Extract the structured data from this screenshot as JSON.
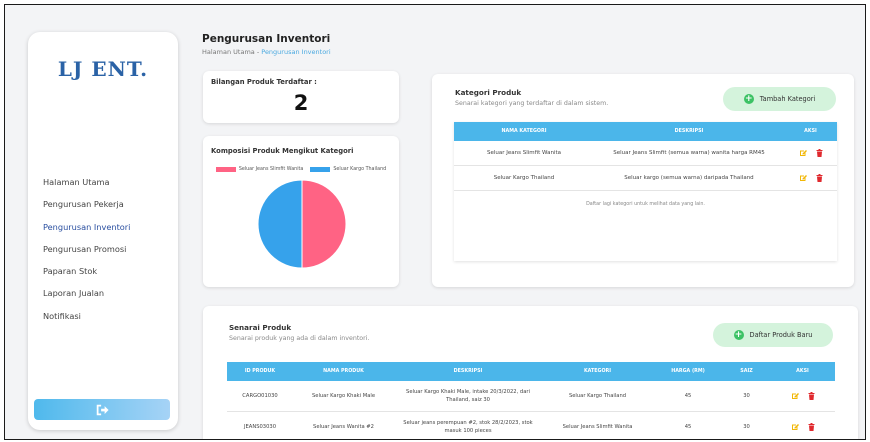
{
  "app": {
    "logo": "LJ ENT."
  },
  "sidebar": {
    "items": [
      {
        "label": "Halaman Utama"
      },
      {
        "label": "Pengurusan Pekerja"
      },
      {
        "label": "Pengurusan Inventori",
        "active": true
      },
      {
        "label": "Pengurusan Promosi"
      },
      {
        "label": "Paparan Stok"
      },
      {
        "label": "Laporan Jualan"
      },
      {
        "label": "Notifikasi"
      }
    ],
    "logout_icon": "logout-icon"
  },
  "header": {
    "title": "Pengurusan Inventori",
    "breadcrumb_root": "Halaman Utama",
    "breadcrumb_sep": " - ",
    "breadcrumb_current": "Pengurusan Inventori"
  },
  "stats": {
    "label": "Bilangan Produk Terdaftar :",
    "value": "2"
  },
  "composition": {
    "title": "Komposisi Produk Mengikut Kategori",
    "legend": [
      "Seluar Jeans Slimfit Wanita",
      "Seluar Kargo Thailand"
    ]
  },
  "chart_data": {
    "type": "pie",
    "title": "Komposisi Produk Mengikut Kategori",
    "categories": [
      "Seluar Jeans Slimfit Wanita",
      "Seluar Kargo Thailand"
    ],
    "values": [
      1,
      1
    ],
    "colors": [
      "#ff6384",
      "#36a2eb"
    ],
    "legend": "top"
  },
  "categories": {
    "title": "Kategori Produk",
    "subtitle": "Senarai kategori yang terdaftar di dalam sistem.",
    "add_button": "Tambah Kategori",
    "columns": [
      "NAMA KATEGORI",
      "DESKRIPSI",
      "AKSI"
    ],
    "rows": [
      {
        "name": "Seluar Jeans Slimfit Wanita",
        "description": "Seluar Jeans Slimfit (semua warna) wanita harga RM45"
      },
      {
        "name": "Seluar Kargo Thailand",
        "description": "Seluar kargo (semua warna) daripada Thailand"
      }
    ],
    "footer_note": "Daftar lagi kategori untuk melihat data yang lain."
  },
  "products": {
    "title": "Senarai Produk",
    "subtitle": "Senarai produk yang ada di dalam inventori.",
    "add_button": "Daftar Produk Baru",
    "columns": [
      "ID PRODUK",
      "NAMA PRODUK",
      "DESKRIPSI",
      "KATEGORI",
      "HARGA (RM)",
      "SAIZ",
      "AKSI"
    ],
    "rows": [
      {
        "id": "CARGO01030",
        "name": "Seluar Kargo Khaki Male",
        "description": "Seluar Kargo Khaki Male, intake 20/3/2022, dari Thailand, saiz 30",
        "category": "Seluar Kargo Thailand",
        "price": "45",
        "size": "30"
      },
      {
        "id": "JEANS03030",
        "name": "Seluar Jeans Wanita #2",
        "description": "Seluar jeans perempuan #2, stok 28/2/2023, stok masuk 100 pieces",
        "category": "Seluar Jeans Slimfit Wanita",
        "price": "45",
        "size": "30"
      }
    ]
  },
  "colors": {
    "accent_blue": "#4bb6ea",
    "button_green_bg": "#d4f3dc",
    "plus_green": "#3cc265",
    "edit_yellow": "#f2b705",
    "delete_red": "#e0292e"
  }
}
